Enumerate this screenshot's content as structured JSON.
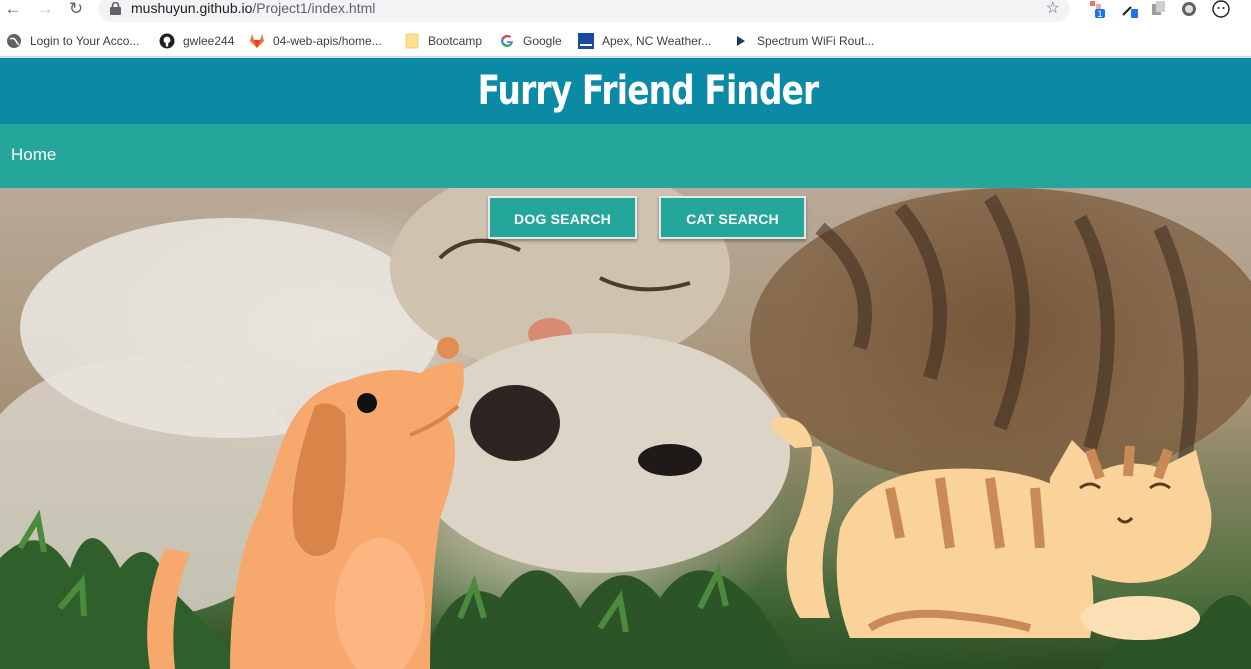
{
  "browser": {
    "url_host": "mushuyun.github.io",
    "url_path": "/Project1/index.html",
    "extension_badge": "1",
    "bookmarks": [
      {
        "label": "Login to Your Acco...",
        "icon": "globe-icon"
      },
      {
        "label": "gwlee244",
        "icon": "github-icon"
      },
      {
        "label": "04-web-apis/home...",
        "icon": "gitlab-icon"
      },
      {
        "label": "Bootcamp",
        "icon": "folder-icon"
      },
      {
        "label": "Google",
        "icon": "google-icon"
      },
      {
        "label": "Apex, NC Weather...",
        "icon": "weather-channel-icon"
      },
      {
        "label": "Spectrum WiFi Rout...",
        "icon": "play-icon"
      }
    ]
  },
  "site": {
    "title": "Furry Friend Finder",
    "nav": {
      "home": "Home"
    },
    "buttons": {
      "dog_search": "DOG SEARCH",
      "cat_search": "CAT SEARCH"
    }
  },
  "colors": {
    "header": "#0b8aa6",
    "nav": "#25a69a",
    "button": "#25a69a",
    "dog": "#f7a86d",
    "cat": "#f9d39a"
  }
}
